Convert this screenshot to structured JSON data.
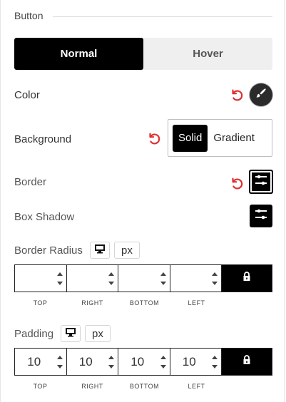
{
  "section": {
    "title": "Button"
  },
  "tabs": [
    {
      "label": "Normal",
      "active": true
    },
    {
      "label": "Hover",
      "active": false
    }
  ],
  "color": {
    "label": "Color",
    "icon": "brush-icon"
  },
  "background": {
    "label": "Background",
    "options": [
      "Solid",
      "Gradient"
    ],
    "selected": "Solid"
  },
  "border": {
    "label": "Border",
    "icon": "sliders-icon"
  },
  "box_shadow": {
    "label": "Box Shadow",
    "icon": "sliders-icon"
  },
  "border_radius": {
    "label": "Border Radius",
    "unit": "px",
    "values": {
      "top": "",
      "right": "",
      "bottom": "",
      "left": ""
    },
    "sides": [
      "TOP",
      "RIGHT",
      "BOTTOM",
      "LEFT"
    ]
  },
  "padding": {
    "label": "Padding",
    "unit": "px",
    "values": {
      "top": "10",
      "right": "10",
      "bottom": "10",
      "left": "10"
    },
    "sides": [
      "TOP",
      "RIGHT",
      "BOTTOM",
      "LEFT"
    ]
  },
  "colors": {
    "accent": "#000000",
    "reset": "#e03030"
  }
}
